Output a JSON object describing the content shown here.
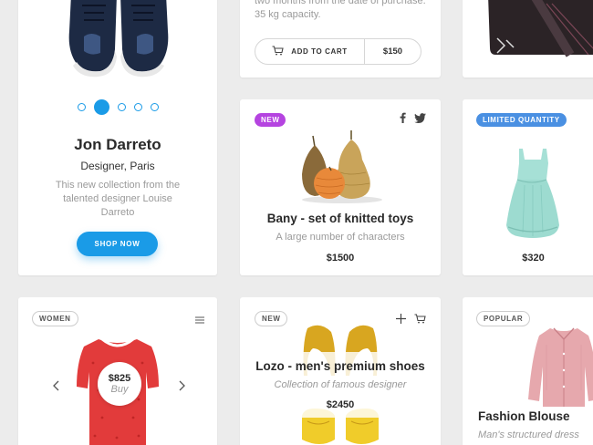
{
  "profile_card": {
    "name": "Jon Darreto",
    "role": "Designer, Paris",
    "description": "This new collection from the talented designer Louise Darreto",
    "cta_label": "SHOP NOW",
    "carousel_dots": 5,
    "active_dot": 2
  },
  "cart_card": {
    "text_line1": "two months from the date of purchase.",
    "text_line2": "35 kg capacity.",
    "add_to_cart_label": "ADD TO CART",
    "price": "$150"
  },
  "toys_card": {
    "badge": "NEW",
    "title": "Bany - set of knitted toys",
    "subtitle": "A large number of characters",
    "price": "$1500"
  },
  "dress_card": {
    "badge": "LIMITED QUANTITY",
    "price": "$320"
  },
  "women_card": {
    "badge": "WOMEN",
    "price": "$825",
    "buy_label": "Buy"
  },
  "shoes_card": {
    "badge": "NEW",
    "title": "Lozo - men's premium shoes",
    "subtitle": "Collection of famous designer",
    "price": "$2450"
  },
  "blouse_card": {
    "badge": "POPULAR",
    "title": "Fashion Blouse",
    "subtitle": "Man's structured dress"
  },
  "colors": {
    "accent": "#1a9be7",
    "badge_new": "#b544e0",
    "badge_limited": "#4a90e2",
    "background": "#ececec"
  },
  "icons": [
    "cart-icon",
    "facebook-icon",
    "twitter-icon",
    "menu-icon",
    "plus-icon",
    "chevron-left-icon",
    "chevron-right-icon"
  ]
}
